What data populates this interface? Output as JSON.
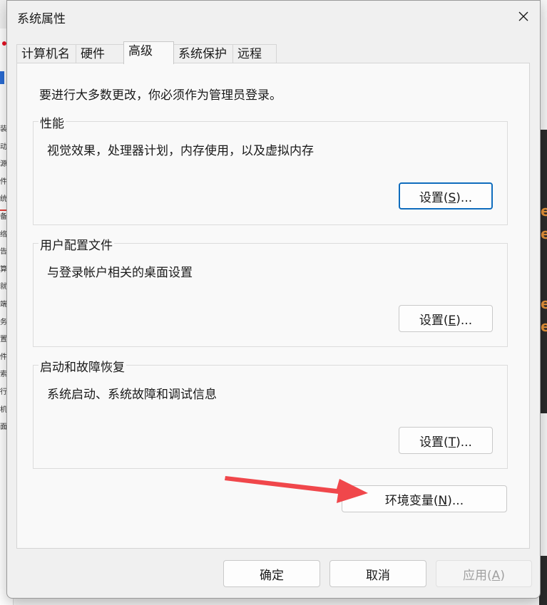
{
  "background": {
    "left_chars": [
      "装",
      "动",
      "源",
      "件",
      "统",
      "备",
      "络",
      "告",
      "算",
      "就",
      "端",
      "务",
      "置",
      "件",
      "索",
      "行",
      "机",
      "面"
    ],
    "right_glyphs": [
      "e",
      "e",
      "e",
      "e"
    ]
  },
  "dialog": {
    "title": "系统属性",
    "tabs": [
      {
        "label": "计算机名",
        "active": false
      },
      {
        "label": "硬件",
        "active": false
      },
      {
        "label": "高级",
        "active": true
      },
      {
        "label": "系统保护",
        "active": false
      },
      {
        "label": "远程",
        "active": false
      }
    ],
    "admin_note": "要进行大多数更改，你必须作为管理员登录。",
    "groups": {
      "performance": {
        "title": "性能",
        "desc": "视觉效果，处理器计划，内存使用，以及虚拟内存",
        "button": "设置(S)...",
        "button_accel": "S"
      },
      "user_profiles": {
        "title": "用户配置文件",
        "desc": "与登录帐户相关的桌面设置",
        "button": "设置(E)...",
        "button_accel": "E"
      },
      "startup_recovery": {
        "title": "启动和故障恢复",
        "desc": "系统启动、系统故障和调试信息",
        "button": "设置(T)...",
        "button_accel": "T"
      }
    },
    "env_button": "环境变量(N)...",
    "env_accel": "N",
    "footer": {
      "ok": "确定",
      "cancel": "取消",
      "apply": "应用(A)",
      "apply_accel": "A"
    },
    "colors": {
      "focus": "#0f6cbd",
      "arrow": "#f0474b",
      "disabled_text": "#a0a0a0"
    }
  }
}
